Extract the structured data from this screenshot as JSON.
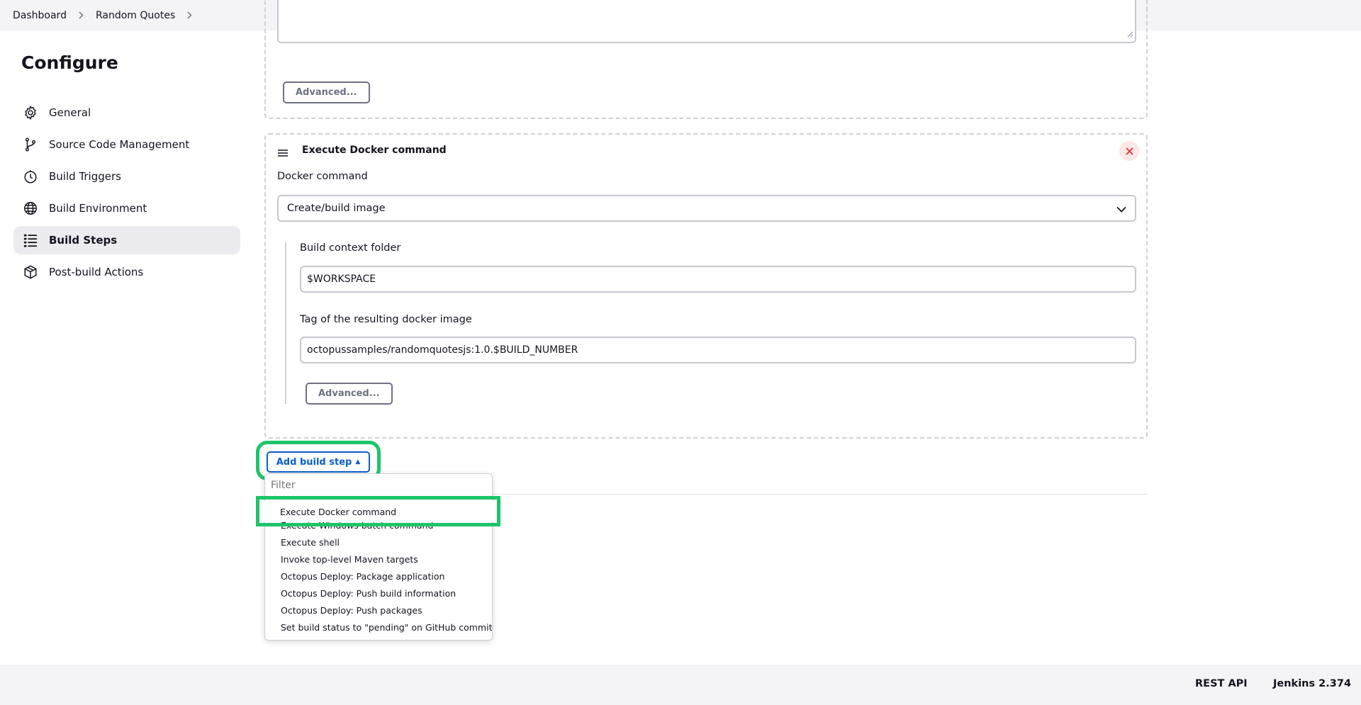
{
  "breadcrumb": {
    "items": [
      "Dashboard",
      "Random Quotes"
    ]
  },
  "page": {
    "title": "Configure"
  },
  "sidebar": {
    "items": [
      {
        "label": "General",
        "icon": "gear-icon"
      },
      {
        "label": "Source Code Management",
        "icon": "git-branch-icon"
      },
      {
        "label": "Build Triggers",
        "icon": "timer-icon"
      },
      {
        "label": "Build Environment",
        "icon": "globe-icon"
      },
      {
        "label": "Build Steps",
        "icon": "list-icon",
        "active": true
      },
      {
        "label": "Post-build Actions",
        "icon": "package-icon"
      }
    ]
  },
  "previous_step": {
    "advanced_label": "Advanced..."
  },
  "docker_step": {
    "title": "Execute Docker command",
    "command_label": "Docker command",
    "command_value": "Create/build image",
    "context_label": "Build context folder",
    "context_value": "$WORKSPACE",
    "tag_label": "Tag of the resulting docker image",
    "tag_value": "octopussamples/randomquotesjs:1.0.$BUILD_NUMBER",
    "advanced_label": "Advanced..."
  },
  "add_step": {
    "label": "Add build step",
    "filter_placeholder": "Filter",
    "options": [
      "Execute Docker command",
      "Execute Windows batch command",
      "Execute shell",
      "Invoke top-level Maven targets",
      "Octopus Deploy: Package application",
      "Octopus Deploy: Push build information",
      "Octopus Deploy: Push packages",
      "Set build status to \"pending\" on GitHub commit"
    ]
  },
  "footer": {
    "rest_api": "REST API",
    "version": "Jenkins 2.374"
  },
  "colors": {
    "accent": "#0b5fc9",
    "highlight": "#1ec46a",
    "danger": "#e03131"
  }
}
